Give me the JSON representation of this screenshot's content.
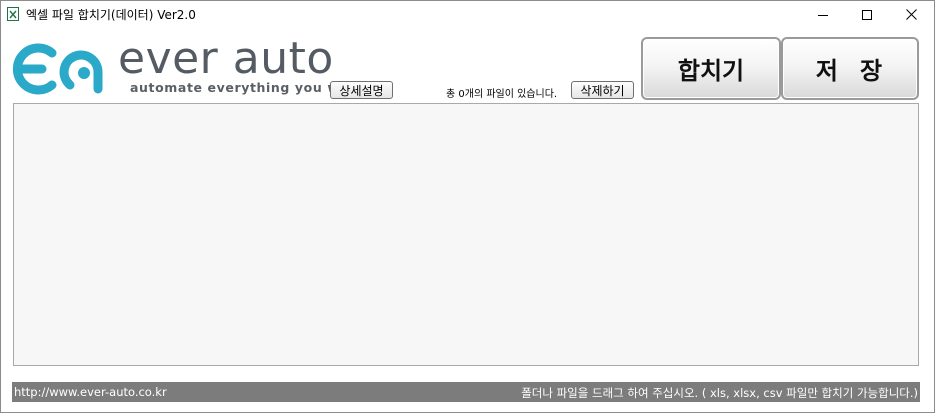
{
  "window": {
    "title": "엑셀 파일 합치기(데이터) Ver2.0",
    "controls": {
      "minimize_icon": "minimize-icon",
      "maximize_icon": "maximize-icon",
      "close_icon": "close-icon"
    }
  },
  "header": {
    "brand_name": "ever auto",
    "tagline": "automate everything you want",
    "details_button": "상세설명",
    "file_count_text": "총 0개의 파일이 있습니다.",
    "delete_button": "삭제하기",
    "merge_button": "합치기",
    "save_button": "저장"
  },
  "drop_area": {
    "files": []
  },
  "statusbar": {
    "url": "http://www.ever-auto.co.kr",
    "hint": "폴더나 파일을 드래그 하여 주십시오. ( xls, xlsx, csv 파일만 합치기 가능합니다.)"
  },
  "colors": {
    "brand_teal": "#2aa9c9",
    "brand_gray": "#555b62",
    "statusbar_bg": "#7c7c7c",
    "drop_area_bg": "#f7f7f7"
  }
}
